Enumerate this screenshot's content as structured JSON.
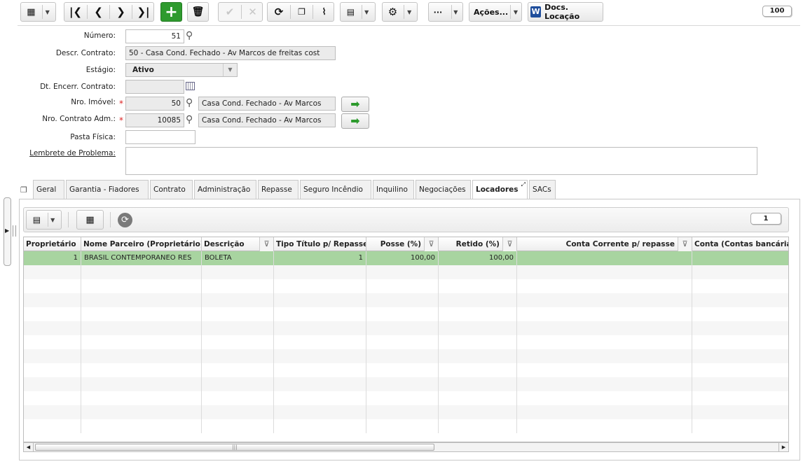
{
  "toolbar": {
    "grid_icon": "grid-icon",
    "first_icon": "first-record-icon",
    "prev_icon": "previous-record-icon",
    "next_icon": "next-record-icon",
    "last_icon": "last-record-icon",
    "add_icon": "plus-icon",
    "delete_icon": "trash-icon",
    "confirm_icon": "check-icon",
    "cancel_icon": "close-icon",
    "refresh_icon": "refresh-icon",
    "copy_icon": "copy-icon",
    "attach_icon": "paperclip-icon",
    "export_icon": "export-icon",
    "settings_icon": "gear-icon",
    "more_label": "···",
    "actions_label": "Ações...",
    "docs_label": "Docs. Locação",
    "word_icon_letter": "W",
    "record_count": "100"
  },
  "form": {
    "numero_label": "Número:",
    "numero_value": "51",
    "descr_label": "Descr. Contrato:",
    "descr_value": "50 - Casa Cond. Fechado - Av Marcos de freitas cost",
    "estagio_label": "Estágio:",
    "estagio_value": "Ativo",
    "dt_encerr_label": "Dt. Encerr. Contrato:",
    "dt_encerr_value": "",
    "nro_imovel_label": "Nro. Imóvel:",
    "nro_imovel_value": "50",
    "nro_imovel_desc": "Casa Cond. Fechado - Av Marcos",
    "nro_contrato_label": "Nro. Contrato Adm.:",
    "nro_contrato_value": "10085",
    "nro_contrato_desc": "Casa Cond. Fechado - Av Marcos",
    "pasta_label": "Pasta Física:",
    "pasta_value": "",
    "lembrete_label": "Lembrete de Problema:",
    "lembrete_value": "",
    "required_mark": "*"
  },
  "tabs": [
    "Geral",
    "Garantia - Fiadores",
    "Contrato",
    "Administração",
    "Repasse",
    "Seguro Incêndio",
    "Inquilino",
    "Negociações",
    "Locadores",
    "SACs"
  ],
  "active_tab": "Locadores",
  "grid": {
    "record_count": "1",
    "columns": [
      "Proprietário",
      "Nome Parceiro (Proprietário)",
      "Descrição",
      "Tipo Título p/ Repasse",
      "Posse (%)",
      "Retido (%)",
      "Conta Corrente p/ repasse",
      "Conta (Contas bancárias"
    ],
    "rows": [
      [
        "1",
        "BRASIL CONTEMPORANEO RES",
        "BOLETA",
        "1",
        "100,00",
        "100,00",
        "",
        ""
      ]
    ],
    "scroll_grip": "|||"
  },
  "colors": {
    "selected_row": "#a8d4a0",
    "add_button": "#2e9a2e",
    "required": "#dd2222",
    "go_arrow": "#2c9a2c"
  }
}
